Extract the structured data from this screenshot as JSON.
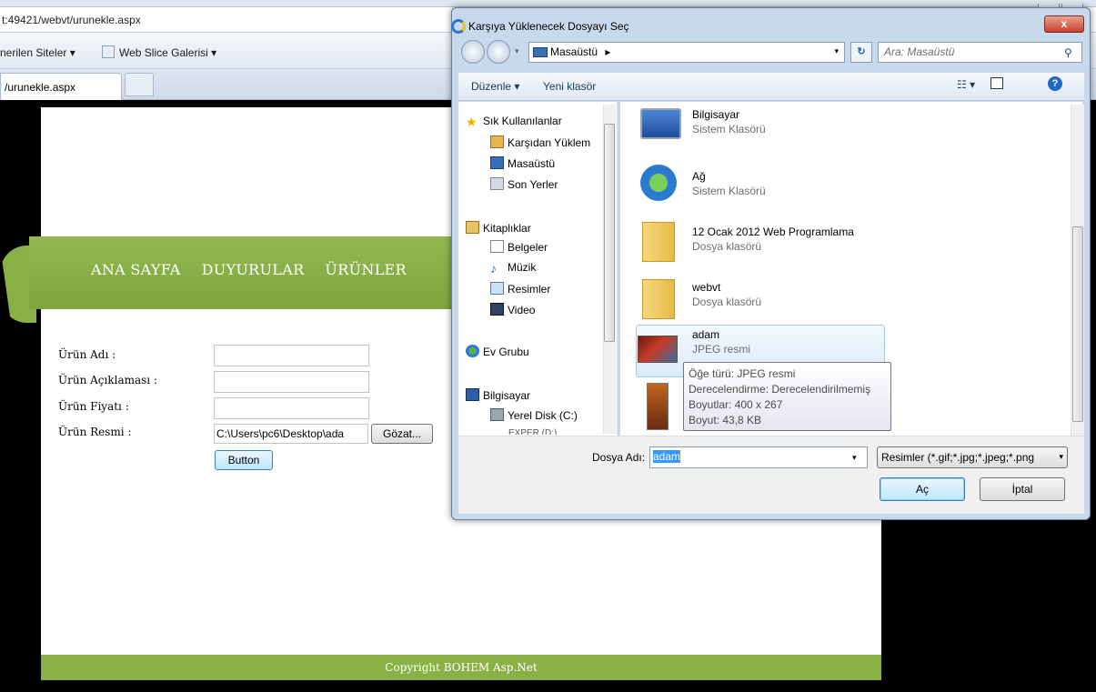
{
  "browser": {
    "address": "t:49421/webvt/urunekle.aspx",
    "favorites": [
      "nerilen Siteler ▾",
      "Web Slice Galerisi ▾"
    ],
    "tab_title": "/urunekle.aspx"
  },
  "site": {
    "nav": [
      "ANA SAYFA",
      "DUYURULAR",
      "ÜRÜNLER"
    ],
    "form": {
      "name_label": "Ürün Adı :",
      "desc_label": "Ürün Açıklaması :",
      "price_label": "Ürün Fiyatı :",
      "image_label": "Ürün Resmi :",
      "file_value": "C:\\Users\\pc6\\Desktop\\ada",
      "browse_label": "Gözat...",
      "submit_label": "Button"
    },
    "footer": "Copyright BOHEM Asp.Net",
    "colors": {
      "accent": "#8ab145",
      "footer_text": "#ffffff"
    }
  },
  "dialog": {
    "title": "Karşıya Yüklenecek Dosyayı Seç",
    "close_label": "x",
    "path": "Masaüstü",
    "path_arrow": "▸",
    "search_placeholder": "Ara: Masaüstü",
    "toolbar": {
      "organize": "Düzenle ▾",
      "new_folder": "Yeni klasör"
    },
    "nav_items": [
      {
        "label": "Sık Kullanılanlar",
        "icon": "star-icon"
      },
      {
        "label": "Karşıdan Yüklem",
        "icon": "downloads-icon"
      },
      {
        "label": "Masaüstü",
        "icon": "desktop-icon"
      },
      {
        "label": "Son Yerler",
        "icon": "recent-icon"
      },
      {
        "label": "Kitaplıklar",
        "icon": "library-icon"
      },
      {
        "label": "Belgeler",
        "icon": "documents-icon"
      },
      {
        "label": "Müzik",
        "icon": "music-icon"
      },
      {
        "label": "Resimler",
        "icon": "pictures-icon"
      },
      {
        "label": "Video",
        "icon": "video-icon"
      },
      {
        "label": "Ev Grubu",
        "icon": "homegroup-icon"
      },
      {
        "label": "Bilgisayar",
        "icon": "computer-icon"
      },
      {
        "label": "Yerel Disk (C:)",
        "icon": "drive-icon"
      },
      {
        "label": "EXPER (D:)",
        "icon": "drive-icon"
      }
    ],
    "files": [
      {
        "name": "Bilgisayar",
        "type": "Sistem Klasörü",
        "icon": "computer-icon"
      },
      {
        "name": "Ağ",
        "type": "Sistem Klasörü",
        "icon": "network-icon"
      },
      {
        "name": "12 Ocak 2012 Web Programlama",
        "type": "Dosya klasörü",
        "icon": "folder-icon"
      },
      {
        "name": "webvt",
        "type": "Dosya klasörü",
        "icon": "folder-icon"
      },
      {
        "name": "adam",
        "type": "JPEG resmi",
        "icon": "image-thumbnail-icon"
      }
    ],
    "tooltip": {
      "line1": "Öğe türü: JPEG resmi",
      "line2": "Derecelendirme: Derecelendirilmemiş",
      "line3": "Boyutlar: 400 x 267",
      "line4": "Boyut: 43,8 KB"
    },
    "filename_label": "Dosya Adı:",
    "filename_value": "adam",
    "filter": "Resimler (*.gif;*.jpg;*.jpeg;*.png",
    "open_label": "Aç",
    "cancel_label": "İptal"
  }
}
